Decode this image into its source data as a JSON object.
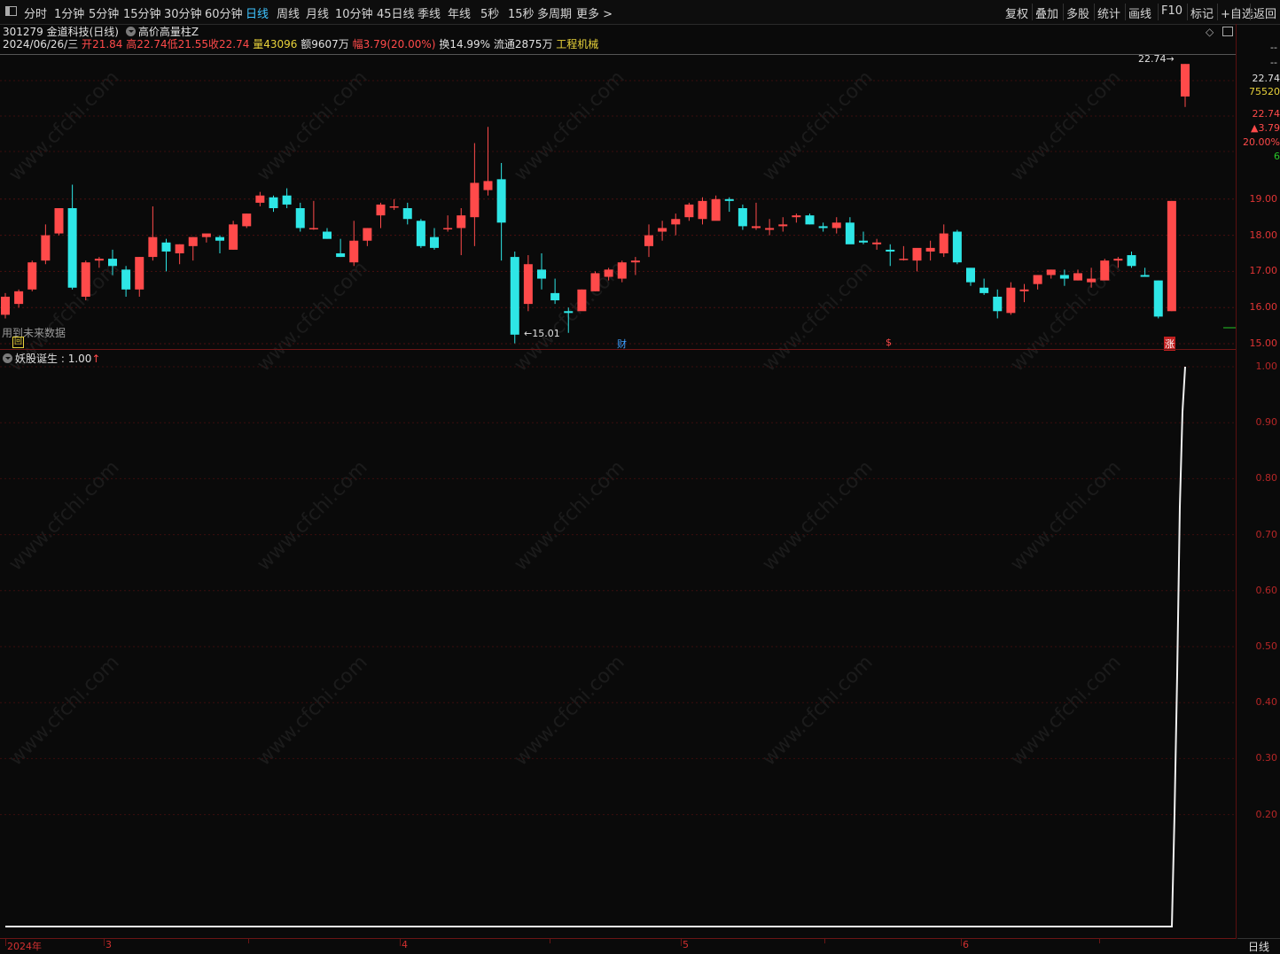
{
  "toolbar": {
    "periods": [
      "分时",
      "1分钟",
      "5分钟",
      "15分钟",
      "30分钟",
      "60分钟",
      "日线",
      "周线",
      "月线",
      "10分钟",
      "45日线",
      "季线",
      "年线",
      "5秒",
      "15秒",
      "多周期",
      "更多 >"
    ],
    "active_period": "日线",
    "right": [
      "复权",
      "叠加",
      "多股",
      "统计",
      "画线",
      "F10",
      "标记",
      "+自选",
      "返回"
    ]
  },
  "stock": {
    "code_name": "301279 金道科技(日线)",
    "indicator": "高价高量柱Z"
  },
  "quote": {
    "date": "2024/06/26/三",
    "open_label": "开",
    "open": "21.84",
    "high_label": "高",
    "high": "22.74",
    "low_label": "低",
    "low": "21.55",
    "close_label": "收",
    "close": "22.74",
    "volume_label": "量",
    "volume": "43096",
    "amount_label": "额",
    "amount": "9607万",
    "change_label": "幅",
    "change": "3.79(20.00%)",
    "turnover": "换14.99%",
    "float_cap": "流通2875万",
    "sector": "工程机械"
  },
  "right_panel": {
    "dash1": "--",
    "dash2": "--",
    "price": "22.74",
    "vol": "75520",
    "price2": "22.74",
    "change": "▲3.79",
    "pct": "20.00%",
    "num": "6"
  },
  "price_axis": [
    "19.00",
    "18.00",
    "17.00",
    "16.00",
    "15.00"
  ],
  "annotations": {
    "high_tag": "22.74",
    "low_tag": "15.01",
    "future_note": "用到未来数据",
    "cai": "财",
    "dollar": "$",
    "zhang": "涨"
  },
  "sub_indicator": {
    "name": "妖股诞生",
    "value_text": ": 1.00",
    "arrow": "↑",
    "axis": [
      "1.00",
      "0.90",
      "0.80",
      "0.70",
      "0.60",
      "0.50",
      "0.40",
      "0.30",
      "0.20"
    ]
  },
  "date_axis": [
    "2024年",
    "3",
    "4",
    "5",
    "6"
  ],
  "bottom_right_label": "日线",
  "watermark": "www.cfchi.com",
  "colors": {
    "up": "#ff4a4a",
    "down": "#2ee6e6",
    "bg": "#0a0a0a",
    "grid": "#4a1010"
  },
  "chart_data": {
    "type": "candlestick",
    "title": "301279 金道科技(日线)",
    "ohlc": [
      [
        15.8,
        16.4,
        15.7,
        16.3
      ],
      [
        16.1,
        16.5,
        16.0,
        16.45
      ],
      [
        16.5,
        17.3,
        16.45,
        17.25
      ],
      [
        17.3,
        18.3,
        17.2,
        18.0
      ],
      [
        18.05,
        18.7,
        18.0,
        18.75
      ],
      [
        18.75,
        19.4,
        16.5,
        16.55
      ],
      [
        16.3,
        17.3,
        16.2,
        17.25
      ],
      [
        17.3,
        17.4,
        17.1,
        17.35
      ],
      [
        17.35,
        17.6,
        16.9,
        17.15
      ],
      [
        17.05,
        17.15,
        16.3,
        16.5
      ],
      [
        16.5,
        17.4,
        16.3,
        17.4
      ],
      [
        17.4,
        18.8,
        17.3,
        17.95
      ],
      [
        17.8,
        17.9,
        17.0,
        17.55
      ],
      [
        17.5,
        17.75,
        17.2,
        17.75
      ],
      [
        17.7,
        17.95,
        17.3,
        17.95
      ],
      [
        17.95,
        18.0,
        17.8,
        18.05
      ],
      [
        17.95,
        18.0,
        17.5,
        17.85
      ],
      [
        17.6,
        18.4,
        17.6,
        18.3
      ],
      [
        18.25,
        18.6,
        18.2,
        18.6
      ],
      [
        18.9,
        19.2,
        18.8,
        19.1
      ],
      [
        19.05,
        19.1,
        18.65,
        18.75
      ],
      [
        19.1,
        19.3,
        18.75,
        18.85
      ],
      [
        18.75,
        18.9,
        18.1,
        18.2
      ],
      [
        18.2,
        18.95,
        18.15,
        18.2
      ],
      [
        18.1,
        18.2,
        17.9,
        17.9
      ],
      [
        17.5,
        17.9,
        17.4,
        17.4
      ],
      [
        17.25,
        18.4,
        17.15,
        17.85
      ],
      [
        17.85,
        18.2,
        17.7,
        18.2
      ],
      [
        18.55,
        18.9,
        18.2,
        18.85
      ],
      [
        18.8,
        19.0,
        18.7,
        18.8
      ],
      [
        18.75,
        18.9,
        18.3,
        18.45
      ],
      [
        18.4,
        18.45,
        17.65,
        17.7
      ],
      [
        17.95,
        18.2,
        17.6,
        17.65
      ],
      [
        18.2,
        18.55,
        18.1,
        18.2
      ],
      [
        18.2,
        18.75,
        17.45,
        18.55
      ],
      [
        18.5,
        20.55,
        17.7,
        19.45
      ],
      [
        19.25,
        21.0,
        19.1,
        19.5
      ],
      [
        19.55,
        20.0,
        17.3,
        18.35
      ],
      [
        17.4,
        17.55,
        15.01,
        15.25
      ],
      [
        16.1,
        17.45,
        15.9,
        17.2
      ],
      [
        17.05,
        17.5,
        16.5,
        16.8
      ],
      [
        16.4,
        16.8,
        16.1,
        16.2
      ],
      [
        15.9,
        16.0,
        15.3,
        15.85
      ],
      [
        15.9,
        16.5,
        16.1,
        16.5
      ],
      [
        16.45,
        17.0,
        16.45,
        16.95
      ],
      [
        16.85,
        17.1,
        16.75,
        17.05
      ],
      [
        16.8,
        17.3,
        16.7,
        17.25
      ],
      [
        17.25,
        17.4,
        16.9,
        17.3
      ],
      [
        17.7,
        18.3,
        17.4,
        18.0
      ],
      [
        18.1,
        18.4,
        17.85,
        18.2
      ],
      [
        18.3,
        18.6,
        18.0,
        18.45
      ],
      [
        18.5,
        18.9,
        18.4,
        18.85
      ],
      [
        18.45,
        19.05,
        18.3,
        18.95
      ],
      [
        18.4,
        19.1,
        18.45,
        19.0
      ],
      [
        19.0,
        19.05,
        18.65,
        18.95
      ],
      [
        18.75,
        18.85,
        18.15,
        18.25
      ],
      [
        18.2,
        18.9,
        18.15,
        18.25
      ],
      [
        18.15,
        18.45,
        18.0,
        18.2
      ],
      [
        18.25,
        18.5,
        18.1,
        18.3
      ],
      [
        18.5,
        18.6,
        18.35,
        18.55
      ],
      [
        18.55,
        18.6,
        18.3,
        18.3
      ],
      [
        18.25,
        18.35,
        18.1,
        18.2
      ],
      [
        18.2,
        18.5,
        18.05,
        18.35
      ],
      [
        18.35,
        18.5,
        17.8,
        17.75
      ],
      [
        17.85,
        18.1,
        17.75,
        17.8
      ],
      [
        17.75,
        17.9,
        17.6,
        17.8
      ],
      [
        17.6,
        17.75,
        17.15,
        17.55
      ],
      [
        17.35,
        17.7,
        17.3,
        17.35
      ],
      [
        17.3,
        17.55,
        17.0,
        17.65
      ],
      [
        17.55,
        17.85,
        17.3,
        17.65
      ],
      [
        17.5,
        18.3,
        17.4,
        18.05
      ],
      [
        18.1,
        18.15,
        17.2,
        17.25
      ],
      [
        17.1,
        17.1,
        16.6,
        16.7
      ],
      [
        16.55,
        16.8,
        16.35,
        16.4
      ],
      [
        16.3,
        16.5,
        15.7,
        15.9
      ],
      [
        15.85,
        16.7,
        15.8,
        16.55
      ],
      [
        16.45,
        16.65,
        16.15,
        16.5
      ],
      [
        16.65,
        16.9,
        16.5,
        16.9
      ],
      [
        16.9,
        17.05,
        16.8,
        17.05
      ],
      [
        16.9,
        17.05,
        16.6,
        16.8
      ],
      [
        16.75,
        17.05,
        16.75,
        16.95
      ],
      [
        16.7,
        17.1,
        16.55,
        16.8
      ],
      [
        16.75,
        17.35,
        16.75,
        17.3
      ],
      [
        17.3,
        17.4,
        17.1,
        17.35
      ],
      [
        17.45,
        17.55,
        17.1,
        17.15
      ],
      [
        16.9,
        17.1,
        16.85,
        16.85
      ],
      [
        16.75,
        16.75,
        15.7,
        15.75
      ],
      [
        15.9,
        18.95,
        15.9,
        18.95
      ],
      [
        21.84,
        22.74,
        21.55,
        22.74
      ]
    ],
    "sub_series_name": "妖股诞生",
    "sub_values_note": "0 until final bars, rising to 1.00 on last bar"
  }
}
